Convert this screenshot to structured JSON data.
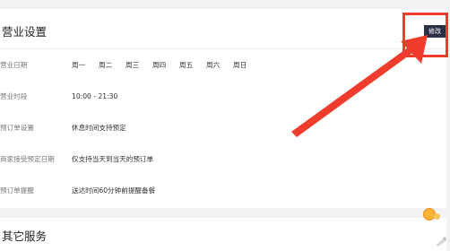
{
  "business_settings": {
    "title": "营业设置",
    "edit_label": "修改",
    "business_days": {
      "label": "营业日期",
      "days": [
        "周一",
        "周二",
        "周三",
        "周四",
        "周五",
        "周六",
        "周日"
      ]
    },
    "business_hours": {
      "label": "营业时段",
      "value": "10:00 - 21:30"
    },
    "reservation_settings": {
      "label": "预订单设置",
      "value": "休息时间支持预定"
    },
    "merchant_accept_date": {
      "label": "商家接受预定日期",
      "value": "仅支持当天到当天的预订单"
    },
    "reservation_reminder": {
      "label": "预订单提醒",
      "value": "送达时间60分钟前提醒备餐"
    }
  },
  "other_services": {
    "title": "其它服务"
  },
  "colors": {
    "annotation_red": "#f03c2c",
    "edit_button_bg": "#2c3148"
  }
}
